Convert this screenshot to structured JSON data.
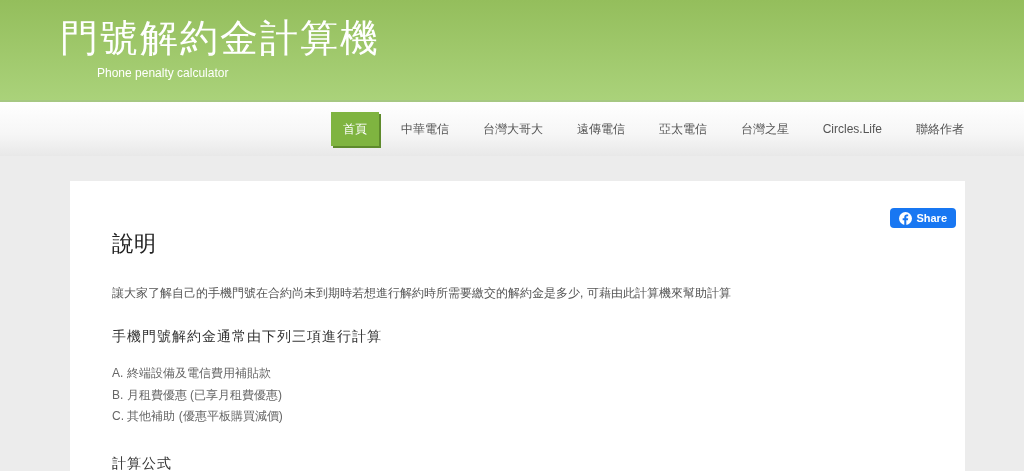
{
  "site": {
    "title": "門號解約金計算機",
    "subtitle": "Phone penalty calculator"
  },
  "nav": [
    {
      "label": "首頁",
      "selected": true
    },
    {
      "label": "中華電信",
      "selected": false
    },
    {
      "label": "台灣大哥大",
      "selected": false
    },
    {
      "label": "遠傳電信",
      "selected": false
    },
    {
      "label": "亞太電信",
      "selected": false
    },
    {
      "label": "台灣之星",
      "selected": false
    },
    {
      "label": "Circles.Life",
      "selected": false
    },
    {
      "label": "聯絡作者",
      "selected": false
    }
  ],
  "share_button": "Share",
  "article": {
    "heading": "說明",
    "intro": "讓大家了解自己的手機門號在合約尚未到期時若想進行解約時所需要繳交的解約金是多少, 可藉由此計算機來幫助計算",
    "subheading": "手機門號解約金通常由下列三項進行計算",
    "items": [
      "A. 終端設備及電信費用補貼款",
      "B. 月租費優惠 (已享月租費優惠)",
      "C. 其他補助 (優惠平板購買減價)"
    ],
    "section_heading": "計算公式"
  }
}
